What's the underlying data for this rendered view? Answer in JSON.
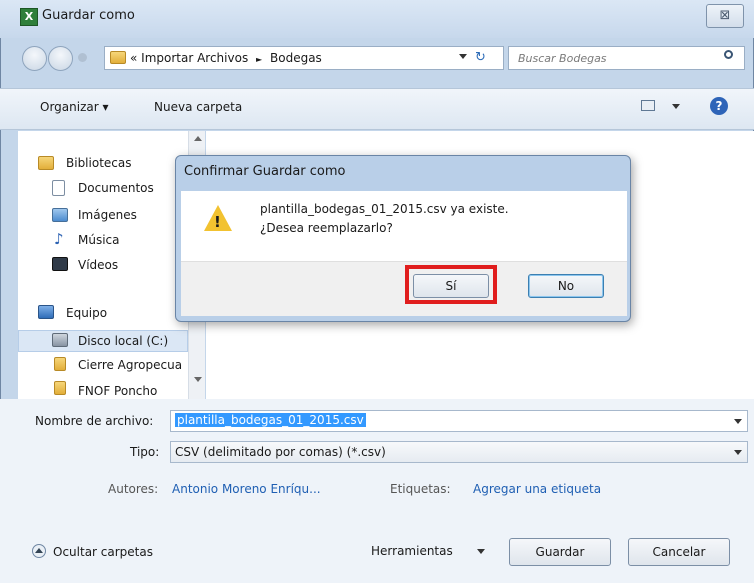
{
  "window": {
    "title": "Guardar como",
    "app_icon": "X",
    "close_glyph": "⊠"
  },
  "nav": {
    "breadcrumb": [
      "« Importar Archivos",
      "Bodegas"
    ],
    "breadcrumb_sep": "►",
    "search_placeholder": "Buscar Bodegas"
  },
  "toolbar": {
    "organize": "Organizar ▾",
    "new_folder": "Nueva carpeta"
  },
  "sidebar": {
    "items": [
      {
        "label": "Bibliotecas",
        "icon": "libraries-icon"
      },
      {
        "label": "Documentos",
        "icon": "documents-icon"
      },
      {
        "label": "Imágenes",
        "icon": "pictures-icon"
      },
      {
        "label": "Música",
        "icon": "music-icon"
      },
      {
        "label": "Vídeos",
        "icon": "videos-icon"
      },
      {
        "label": "Equipo",
        "icon": "computer-icon"
      },
      {
        "label": "Disco local (C:)",
        "icon": "drive-icon"
      },
      {
        "label": "Cierre Agropecua",
        "icon": "folder-icon"
      },
      {
        "label": "FNOF Poncho",
        "icon": "folder-icon"
      }
    ]
  },
  "form": {
    "filename_label": "Nombre de archivo:",
    "filename_value": "plantilla_bodegas_01_2015.csv",
    "type_label": "Tipo:",
    "type_value": "CSV (delimitado por comas) (*.csv)",
    "authors_label": "Autores:",
    "authors_value": "Antonio Moreno Enríqu...",
    "tags_label": "Etiquetas:",
    "tags_value": "Agregar una etiqueta"
  },
  "footer": {
    "hide_folders": "Ocultar carpetas",
    "tools": "Herramientas",
    "save": "Guardar",
    "cancel": "Cancelar"
  },
  "confirm": {
    "title": "Confirmar Guardar como",
    "message_line1": "plantilla_bodegas_01_2015.csv ya existe.",
    "message_line2": "¿Desea reemplazarlo?",
    "yes": "Sí",
    "no": "No"
  },
  "colors": {
    "highlight_border": "#e01d1d",
    "selection": "#3399ff",
    "link": "#1f5fb3"
  }
}
